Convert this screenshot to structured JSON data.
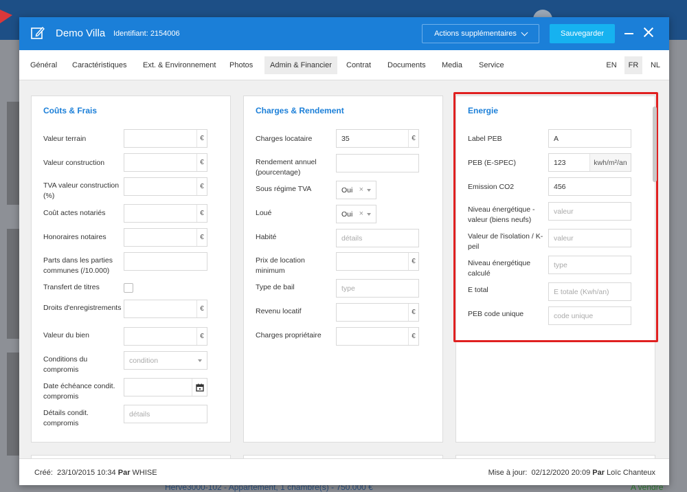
{
  "modal": {
    "title": "Demo Villa",
    "identifier": "Identifiant: 2154006",
    "actions_label": "Actions supplémentaires",
    "save_label": "Sauvegarder"
  },
  "tabs": [
    {
      "label": "Général"
    },
    {
      "label": "Caractéristiques"
    },
    {
      "label": "Ext. & Environnement"
    },
    {
      "label": "Photos"
    },
    {
      "label": "Admin & Financier",
      "active": true
    },
    {
      "label": "Contrat"
    },
    {
      "label": "Documents"
    },
    {
      "label": "Media"
    },
    {
      "label": "Service"
    }
  ],
  "languages": [
    "EN",
    "FR",
    "NL"
  ],
  "active_language": "FR",
  "couts": {
    "title": "Coûts & Frais",
    "fields": [
      {
        "label": "Valeur terrain",
        "value": "",
        "suffix": "€"
      },
      {
        "label": "Valeur construction",
        "value": "",
        "suffix": "€"
      },
      {
        "label": "TVA valeur construction (%)",
        "value": "",
        "suffix": "€"
      },
      {
        "label": "Coût actes notariés",
        "value": "",
        "suffix": "€"
      },
      {
        "label": "Honoraires notaires",
        "value": "",
        "suffix": "€"
      },
      {
        "label": "Parts dans les parties communes (/10.000)",
        "value": ""
      },
      {
        "label": "Transfert de titres"
      },
      {
        "label": "Droits d'enregistrements",
        "value": "",
        "suffix": "€"
      },
      {
        "label": "Valeur du bien",
        "value": "",
        "suffix": "€"
      },
      {
        "label": "Conditions du compromis",
        "placeholder": "condition"
      },
      {
        "label": "Date échéance condit. compromis",
        "value": ""
      },
      {
        "label": "Détails condit. compromis",
        "placeholder": "détails"
      }
    ]
  },
  "charges": {
    "title": "Charges & Rendement",
    "fields": [
      {
        "label": "Charges locataire",
        "value": "35",
        "suffix": "€"
      },
      {
        "label": "Rendement annuel (pourcentage)",
        "value": ""
      },
      {
        "label": "Sous régime TVA",
        "value": "Oui",
        "clear": "×"
      },
      {
        "label": "Loué",
        "value": "Oui",
        "clear": "×"
      },
      {
        "label": "Habité",
        "placeholder": "détails"
      },
      {
        "label": "Prix de location minimum",
        "value": "",
        "suffix": "€"
      },
      {
        "label": "Type de bail",
        "placeholder": "type"
      },
      {
        "label": "Revenu locatif",
        "value": "",
        "suffix": "€"
      },
      {
        "label": "Charges propriétaire",
        "value": "",
        "suffix": "€"
      }
    ]
  },
  "energie": {
    "title": "Energie",
    "fields": [
      {
        "label": "Label PEB",
        "value": "A"
      },
      {
        "label": "PEB (E-SPEC)",
        "value": "123",
        "unit": "kwh/m²/an"
      },
      {
        "label": "Emission CO2",
        "value": "456"
      },
      {
        "label": "Niveau énergétique - valeur (biens neufs)",
        "placeholder": "valeur"
      },
      {
        "label": "Valeur de l'isolation / K-peil",
        "placeholder": "valeur"
      },
      {
        "label": "Niveau énergétique calculé",
        "placeholder": "type"
      },
      {
        "label": "E total",
        "placeholder": "E totale (Kwh/an)"
      },
      {
        "label": "PEB code unique",
        "placeholder": "code unique"
      }
    ]
  },
  "footer": {
    "created_label": "Créé:",
    "created_date": "23/10/2015 10:34",
    "by_label": "Par",
    "created_by": "WHISE",
    "updated_label": "Mise à jour:",
    "updated_date": "02/12/2020 20:09",
    "updated_by": "Loïc Chanteux"
  },
  "background": {
    "listing_link": "Herve3000-102 - Appartement, 1 chambre(s) - 750.000 €",
    "status": "A vendre"
  },
  "colors": {
    "header_blue": "#1b7fd8",
    "save_button": "#16b2f0",
    "section_title": "#1b7fd8",
    "highlight": "#e02020"
  }
}
